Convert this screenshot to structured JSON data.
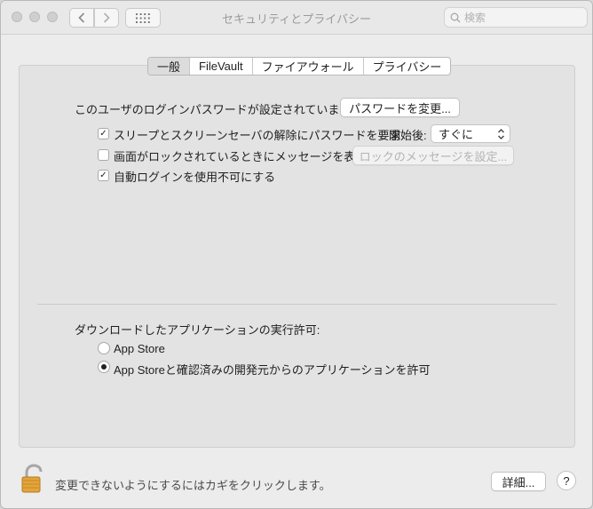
{
  "window": {
    "title": "セキュリティとプライバシー"
  },
  "toolbar": {
    "search_placeholder": "検索"
  },
  "tabs": [
    {
      "label": "一般",
      "selected": true
    },
    {
      "label": "FileVault",
      "selected": false
    },
    {
      "label": "ファイアウォール",
      "selected": false
    },
    {
      "label": "プライバシー",
      "selected": false
    }
  ],
  "general": {
    "password_text": "このユーザのログインパスワードが設定されています",
    "change_password_button": "パスワードを変更...",
    "require_password": {
      "label": "スリープとスクリーンセーバの解除にパスワードを要求",
      "checked": true,
      "after_label": "開始後:",
      "after_value": "すぐに"
    },
    "show_message": {
      "label": "画面がロックされているときにメッセージを表示",
      "checked": false,
      "button": "ロックのメッセージを設定..."
    },
    "disable_autologin": {
      "label": "自動ログインを使用不可にする",
      "checked": true
    },
    "downloads_title": "ダウンロードしたアプリケーションの実行許可:",
    "download_options": [
      {
        "label": "App Store",
        "selected": false
      },
      {
        "label": "App Storeと確認済みの開発元からのアプリケーションを許可",
        "selected": true
      }
    ]
  },
  "footer": {
    "lock_text": "変更できないようにするにはカギをクリックします。",
    "advanced_button": "詳細...",
    "help_label": "?"
  }
}
